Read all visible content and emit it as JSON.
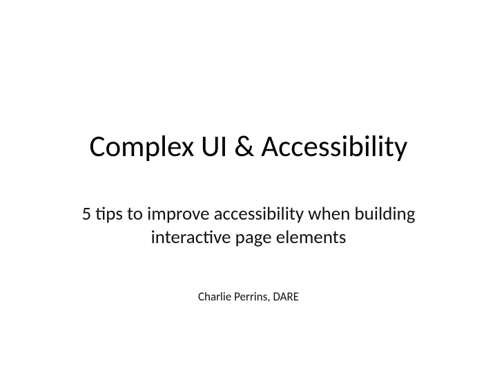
{
  "slide": {
    "title": "Complex UI & Accessibility",
    "subtitle": "5 tips to improve accessibility when building interactive page elements",
    "author": "Charlie Perrins, DARE"
  }
}
